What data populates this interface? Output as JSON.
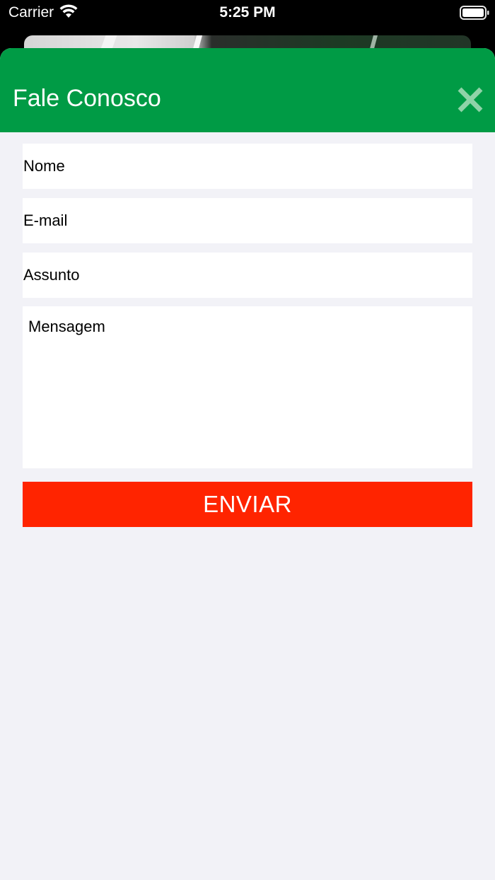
{
  "status_bar": {
    "carrier": "Carrier",
    "time": "5:25 PM"
  },
  "modal": {
    "title": "Fale Conosco",
    "header_color": "#009b45",
    "close_icon": "close-icon"
  },
  "form": {
    "name_placeholder": "Nome",
    "email_placeholder": "E-mail",
    "subject_placeholder": "Assunto",
    "message_placeholder": "Mensagem",
    "submit_label": "ENVIAR",
    "submit_color": "#ff2400"
  }
}
